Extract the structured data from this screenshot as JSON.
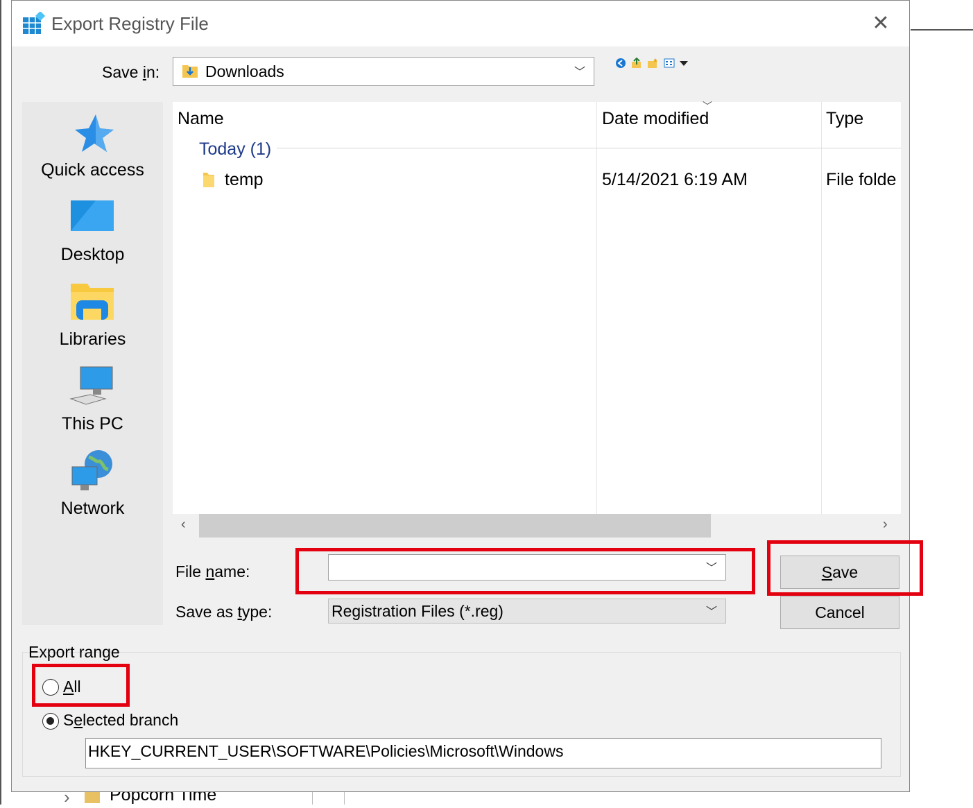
{
  "background": {
    "tree_item_label": "Popcorn Time"
  },
  "dialog": {
    "title": "Export Registry File",
    "close_glyph": "✕",
    "save_in": {
      "label_pre": "Save ",
      "label_mnemonic": "i",
      "label_post": "n:",
      "value": "Downloads"
    },
    "toolbar_icons": [
      "back-icon",
      "up-folder-icon",
      "new-folder-icon",
      "view-menu-icon"
    ],
    "places": [
      {
        "name": "quick-access",
        "label": "Quick access",
        "icon": "star-icon"
      },
      {
        "name": "desktop",
        "label": "Desktop",
        "icon": "desktop-icon"
      },
      {
        "name": "libraries",
        "label": "Libraries",
        "icon": "libraries-icon"
      },
      {
        "name": "this-pc",
        "label": "This PC",
        "icon": "computer-icon"
      },
      {
        "name": "network",
        "label": "Network",
        "icon": "network-icon"
      }
    ],
    "file_list": {
      "columns": [
        "Name",
        "Date modified",
        "Type"
      ],
      "group": "Today (1)",
      "rows": [
        {
          "name": "temp",
          "date": "5/14/2021 6:19 AM",
          "type": "File folde"
        }
      ]
    },
    "file_name": {
      "label_pre": "File ",
      "label_mnemonic": "n",
      "label_post": "ame:",
      "value": ""
    },
    "save_as_type": {
      "label_pre": "Save as ",
      "label_mnemonic": "t",
      "label_post": "ype:",
      "value": "Registration Files (*.reg)"
    },
    "save_button": {
      "mnemonic": "S",
      "rest": "ave"
    },
    "cancel_button": "Cancel",
    "export_range": {
      "label": "Export range",
      "all": {
        "mnemonic": "A",
        "rest": "ll",
        "checked": false
      },
      "selected": {
        "pre": "S",
        "mnemonic": "e",
        "rest": "lected branch",
        "checked": true
      },
      "branch_value": "HKEY_CURRENT_USER\\SOFTWARE\\Policies\\Microsoft\\Windows"
    },
    "highlight_color": "#e3000f"
  }
}
